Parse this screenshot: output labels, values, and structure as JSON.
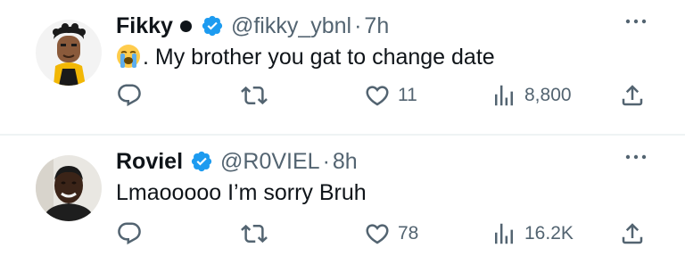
{
  "colors": {
    "text": "#0f1419",
    "secondary": "#536471",
    "verified": "#1d9bf0",
    "divider": "#eff3f4"
  },
  "tweets": [
    {
      "name": "Fikky",
      "handle": "@fikky_ybnl",
      "separator": "·",
      "time": "7h",
      "emoji": "loudly-crying-face-emoji",
      "text": ". My brother you gat to change date",
      "likes": "11",
      "views": "8,800"
    },
    {
      "name": "Roviel",
      "handle": "@R0VIEL",
      "separator": "·",
      "time": "8h",
      "text": "Lmaooooo I’m sorry Bruh",
      "likes": "78",
      "views": "16.2K"
    }
  ]
}
